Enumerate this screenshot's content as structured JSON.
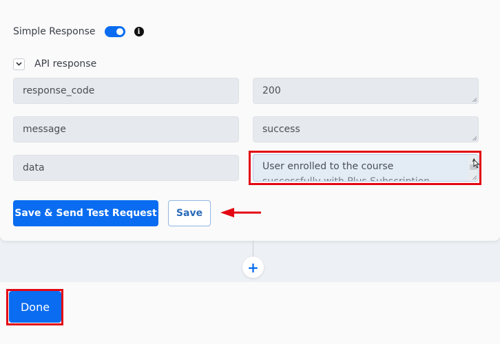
{
  "simple_response": {
    "label": "Simple Response",
    "toggle_on": true,
    "info_icon": "info-circle-icon"
  },
  "api_response": {
    "label": "API response",
    "collapse_icon": "chevron-down-icon",
    "rows": [
      {
        "key": "response_code",
        "value": "200"
      },
      {
        "key": "message",
        "value": "success"
      },
      {
        "key": "data",
        "value": "User enrolled to the course",
        "overflow_text": "successfully with Plus Subscription"
      }
    ]
  },
  "buttons": {
    "save_send": "Save & Send Test Request",
    "save": "Save",
    "add_step": "+",
    "done": "Done"
  },
  "annotations": {
    "highlight_color": "#e30613",
    "arrow_target": "Save"
  },
  "colors": {
    "primary": "#0a6cf0",
    "annotation": "#e30613"
  }
}
